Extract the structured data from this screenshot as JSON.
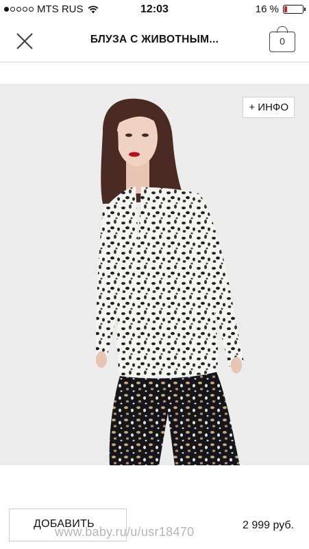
{
  "status_bar": {
    "carrier": "MTS RUS",
    "time": "12:03",
    "battery_percent": "16 %",
    "battery_level": 0.16,
    "signal_bars_filled": 1,
    "signal_bars_total": 5
  },
  "header": {
    "title": "БЛУЗА С ЖИВОТНЫМ...",
    "bag_count": "0"
  },
  "product": {
    "info_label": "+ ИНФО",
    "add_label": "ДОБАВИТЬ",
    "price": "2 999 руб."
  },
  "watermark": "www.baby.ru/u/usr18470",
  "colors": {
    "battery_low": "#d0202a",
    "image_background": "#ececec"
  }
}
